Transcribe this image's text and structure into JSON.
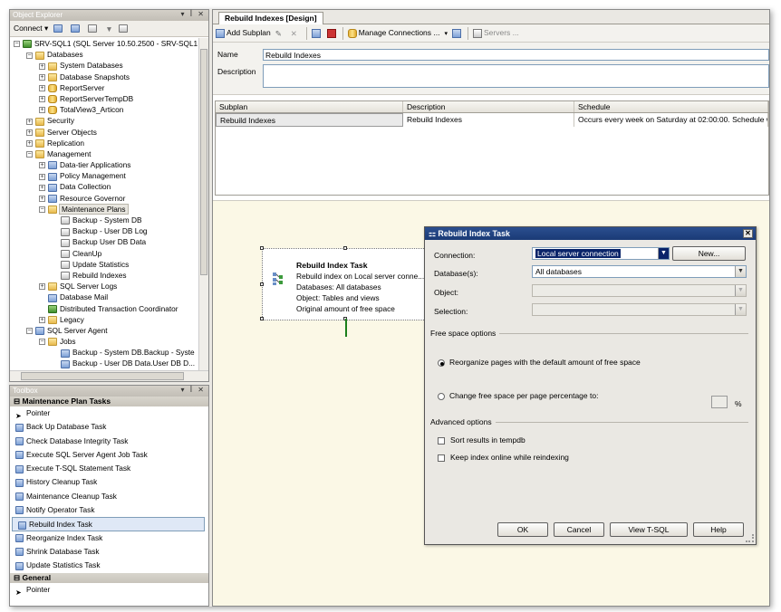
{
  "object_explorer": {
    "title": "Object Explorer",
    "connect_label": "Connect ▾",
    "tree": [
      {
        "indent": 0,
        "exp": "-",
        "icon": "srv",
        "label": "SRV-SQL1 (SQL Server 10.50.2500 - SRV-SQL1"
      },
      {
        "indent": 1,
        "exp": "-",
        "icon": "folder",
        "label": "Databases"
      },
      {
        "indent": 2,
        "exp": "+",
        "icon": "folder",
        "label": "System Databases"
      },
      {
        "indent": 2,
        "exp": "+",
        "icon": "folder",
        "label": "Database Snapshots"
      },
      {
        "indent": 2,
        "exp": "+",
        "icon": "db",
        "label": "ReportServer"
      },
      {
        "indent": 2,
        "exp": "+",
        "icon": "db",
        "label": "ReportServerTempDB"
      },
      {
        "indent": 2,
        "exp": "+",
        "icon": "db",
        "label": "TotalView3_Articon"
      },
      {
        "indent": 1,
        "exp": "+",
        "icon": "folder",
        "label": "Security"
      },
      {
        "indent": 1,
        "exp": "+",
        "icon": "folder",
        "label": "Server Objects"
      },
      {
        "indent": 1,
        "exp": "+",
        "icon": "folder",
        "label": "Replication"
      },
      {
        "indent": 1,
        "exp": "-",
        "icon": "folder",
        "label": "Management"
      },
      {
        "indent": 2,
        "exp": "+",
        "icon": "misc",
        "label": "Data-tier Applications"
      },
      {
        "indent": 2,
        "exp": "+",
        "icon": "misc",
        "label": "Policy Management"
      },
      {
        "indent": 2,
        "exp": "+",
        "icon": "misc",
        "label": "Data Collection"
      },
      {
        "indent": 2,
        "exp": "+",
        "icon": "misc",
        "label": "Resource Governor"
      },
      {
        "indent": 2,
        "exp": "-",
        "icon": "folder",
        "label": "Maintenance Plans",
        "hl": true
      },
      {
        "indent": 3,
        "exp": "",
        "icon": "pkg",
        "label": "Backup - System DB"
      },
      {
        "indent": 3,
        "exp": "",
        "icon": "pkg",
        "label": "Backup - User DB Log"
      },
      {
        "indent": 3,
        "exp": "",
        "icon": "pkg",
        "label": "Backup User DB Data"
      },
      {
        "indent": 3,
        "exp": "",
        "icon": "pkg",
        "label": "CleanUp"
      },
      {
        "indent": 3,
        "exp": "",
        "icon": "pkg",
        "label": "Update Statistics"
      },
      {
        "indent": 3,
        "exp": "",
        "icon": "pkg",
        "label": "Rebuild Indexes"
      },
      {
        "indent": 2,
        "exp": "+",
        "icon": "folder",
        "label": "SQL Server Logs"
      },
      {
        "indent": 2,
        "exp": "",
        "icon": "misc",
        "label": "Database Mail"
      },
      {
        "indent": 2,
        "exp": "",
        "icon": "srv",
        "label": "Distributed Transaction Coordinator"
      },
      {
        "indent": 2,
        "exp": "+",
        "icon": "folder",
        "label": "Legacy"
      },
      {
        "indent": 1,
        "exp": "-",
        "icon": "misc",
        "label": "SQL Server Agent"
      },
      {
        "indent": 2,
        "exp": "-",
        "icon": "folder",
        "label": "Jobs"
      },
      {
        "indent": 3,
        "exp": "",
        "icon": "misc",
        "label": "Backup - System DB.Backup - Syste"
      },
      {
        "indent": 3,
        "exp": "",
        "icon": "misc",
        "label": "Backup - User DB Data.User DB D..."
      }
    ]
  },
  "toolbox": {
    "title": "Toolbox",
    "group1": "Maintenance Plan Tasks",
    "items": [
      {
        "label": "Pointer",
        "icon": "pointer-icon"
      },
      {
        "label": "Back Up Database Task",
        "icon": "backup-icon"
      },
      {
        "label": "Check Database Integrity Task",
        "icon": "check-icon"
      },
      {
        "label": "Execute SQL Server Agent Job Task",
        "icon": "job-icon"
      },
      {
        "label": "Execute T-SQL Statement Task",
        "icon": "tsql-icon"
      },
      {
        "label": "History Cleanup Task",
        "icon": "history-icon"
      },
      {
        "label": "Maintenance Cleanup Task",
        "icon": "cleanup-icon"
      },
      {
        "label": "Notify Operator Task",
        "icon": "notify-icon"
      },
      {
        "label": "Rebuild Index Task",
        "icon": "rebuild-icon",
        "selected": true
      },
      {
        "label": "Reorganize Index Task",
        "icon": "reorganize-icon"
      },
      {
        "label": "Shrink Database Task",
        "icon": "shrink-icon"
      },
      {
        "label": "Update Statistics Task",
        "icon": "stats-icon"
      }
    ],
    "group2": "General",
    "general_items": [
      {
        "label": "Pointer",
        "icon": "pointer-icon"
      }
    ]
  },
  "document": {
    "tab": "Rebuild Indexes [Design]",
    "toolbar": {
      "add_subplan": "Add Subplan",
      "manage_connections": "Manage Connections ...",
      "servers": "Servers ..."
    },
    "name_label": "Name",
    "name_value": "Rebuild Indexes",
    "description_label": "Description",
    "grid": {
      "headers": [
        "Subplan",
        "Description",
        "Schedule"
      ],
      "rows": [
        [
          "Rebuild Indexes",
          "Rebuild Indexes",
          "Occurs every week on Saturday at 02:00:00. Schedule w"
        ]
      ]
    },
    "task_box": {
      "title": "Rebuild Index Task",
      "lines": [
        "Rebuild index on Local server conne...",
        "Databases: All databases",
        "Object: Tables and views",
        "Original amount of free space"
      ]
    }
  },
  "dialog": {
    "title": "Rebuild Index Task",
    "connection_label": "Connection:",
    "connection_value": "Local server connection",
    "new_button": "New...",
    "databases_label": "Database(s):",
    "databases_value": "All databases",
    "object_label": "Object:",
    "selection_label": "Selection:",
    "free_space_header": "Free space options",
    "radio1": "Reorganize pages with the default amount of free space",
    "radio2": "Change free space per page percentage to:",
    "percent_sign": "%",
    "advanced_header": "Advanced options",
    "check1": "Sort results in tempdb",
    "check2": "Keep index online while reindexing",
    "ok": "OK",
    "cancel": "Cancel",
    "view_tsql": "View T-SQL",
    "help": "Help",
    "selection_color": "#0a246a"
  }
}
